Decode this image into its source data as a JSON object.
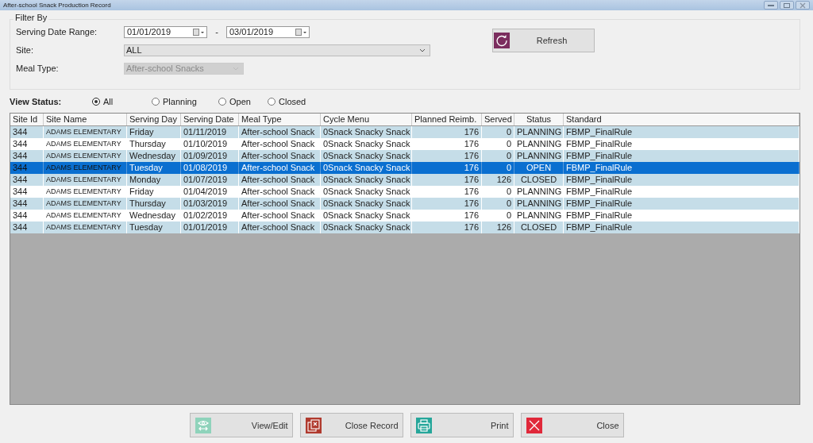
{
  "window": {
    "title": "After-school Snack Production Record"
  },
  "filter": {
    "legend": "Filter By",
    "date_range": {
      "label": "Serving Date Range:",
      "from": "01/01/2019",
      "separator": "-",
      "to": "03/01/2019"
    },
    "site": {
      "label": "Site:",
      "value": "ALL"
    },
    "meal_type": {
      "label": "Meal Type:",
      "value": "After-school Snacks",
      "disabled": true
    },
    "refresh_button": "Refresh"
  },
  "view_status": {
    "label": "View Status:",
    "options": [
      {
        "label": "All",
        "selected": true
      },
      {
        "label": "Planning",
        "selected": false
      },
      {
        "label": "Open",
        "selected": false
      },
      {
        "label": "Closed",
        "selected": false
      }
    ]
  },
  "table": {
    "columns": [
      "Site Id",
      "Site Name",
      "Serving Day",
      "Serving Date",
      "Meal Type",
      "Cycle Menu",
      "Planned Reimb.",
      "Served",
      "Status",
      "Standard"
    ],
    "rows": [
      {
        "cells": [
          "344",
          "ADAMS ELEMENTARY",
          "Friday",
          "01/11/2019",
          "After-school Snack",
          "0Snack Snacky Snack",
          "176",
          "0",
          "PLANNING",
          "FBMP_FinalRule"
        ],
        "selected": false
      },
      {
        "cells": [
          "344",
          "ADAMS ELEMENTARY",
          "Thursday",
          "01/10/2019",
          "After-school Snack",
          "0Snack Snacky Snack",
          "176",
          "0",
          "PLANNING",
          "FBMP_FinalRule"
        ],
        "selected": false
      },
      {
        "cells": [
          "344",
          "ADAMS ELEMENTARY",
          "Wednesday",
          "01/09/2019",
          "After-school Snack",
          "0Snack Snacky Snack",
          "176",
          "0",
          "PLANNING",
          "FBMP_FinalRule"
        ],
        "selected": false
      },
      {
        "cells": [
          "344",
          "ADAMS ELEMENTARY",
          "Tuesday",
          "01/08/2019",
          "After-school Snack",
          "0Snack Snacky Snack",
          "176",
          "0",
          "OPEN",
          "FBMP_FinalRule"
        ],
        "selected": true
      },
      {
        "cells": [
          "344",
          "ADAMS ELEMENTARY",
          "Monday",
          "01/07/2019",
          "After-school Snack",
          "0Snack Snacky Snack",
          "176",
          "126",
          "CLOSED",
          "FBMP_FinalRule"
        ],
        "selected": false
      },
      {
        "cells": [
          "344",
          "ADAMS ELEMENTARY",
          "Friday",
          "01/04/2019",
          "After-school Snack",
          "0Snack Snacky Snack",
          "176",
          "0",
          "PLANNING",
          "FBMP_FinalRule"
        ],
        "selected": false
      },
      {
        "cells": [
          "344",
          "ADAMS ELEMENTARY",
          "Thursday",
          "01/03/2019",
          "After-school Snack",
          "0Snack Snacky Snack",
          "176",
          "0",
          "PLANNING",
          "FBMP_FinalRule"
        ],
        "selected": false
      },
      {
        "cells": [
          "344",
          "ADAMS ELEMENTARY",
          "Wednesday",
          "01/02/2019",
          "After-school Snack",
          "0Snack Snacky Snack",
          "176",
          "0",
          "PLANNING",
          "FBMP_FinalRule"
        ],
        "selected": false
      },
      {
        "cells": [
          "344",
          "ADAMS ELEMENTARY",
          "Tuesday",
          "01/01/2019",
          "After-school Snack",
          "0Snack Snacky Snack",
          "176",
          "126",
          "CLOSED",
          "FBMP_FinalRule"
        ],
        "selected": false
      }
    ]
  },
  "buttons": [
    {
      "kind": "view",
      "label": "View/Edit"
    },
    {
      "kind": "close-record",
      "label": "Close Record"
    },
    {
      "kind": "print",
      "label": "Print"
    },
    {
      "kind": "close",
      "label": "Close"
    }
  ]
}
